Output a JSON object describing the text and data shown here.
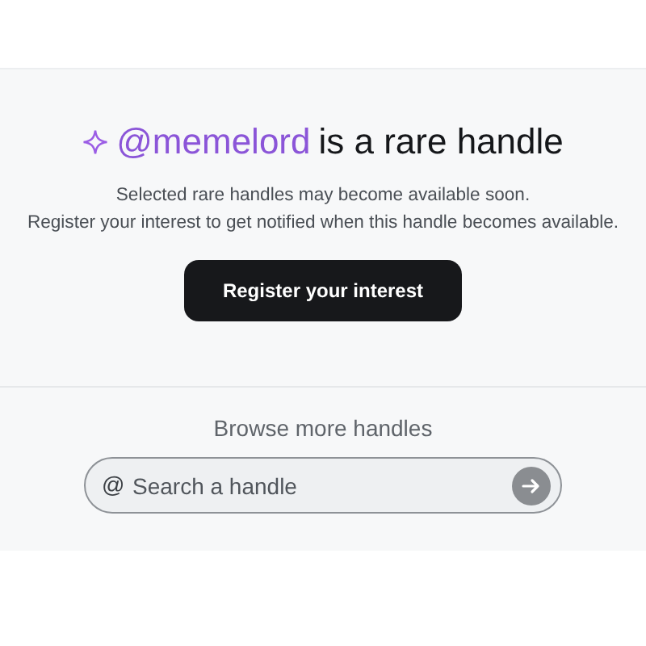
{
  "heading": {
    "handle": "@memelord",
    "text": "is a rare handle"
  },
  "description": [
    "Selected rare handles may become available soon.",
    "Register your interest to get notified when this handle becomes available."
  ],
  "register_button": {
    "label": "Register your interest"
  },
  "browse": {
    "title": "Browse more handles",
    "search": {
      "prefix": "@",
      "placeholder": "Search a handle"
    }
  }
}
